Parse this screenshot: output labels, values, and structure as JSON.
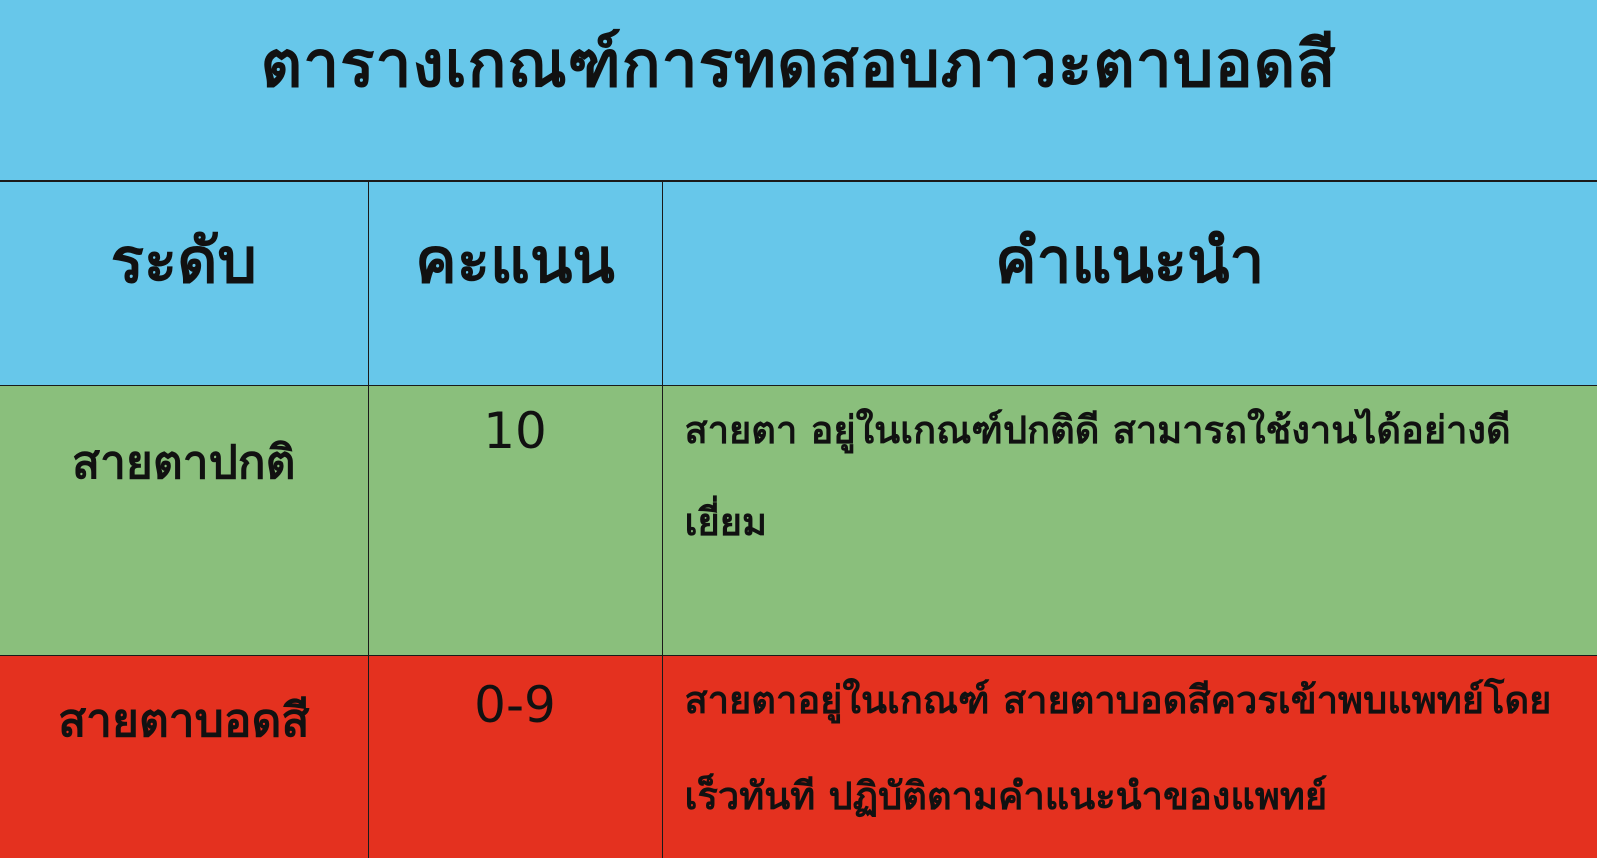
{
  "title": "ตารางเกณฑ์การทดสอบภาวะตาบอดสี",
  "colors": {
    "header_bg": "#67c7ea",
    "normal_bg": "#8abf7c",
    "blind_bg": "#e4311f"
  },
  "table": {
    "headers": [
      "ระดับ",
      "คะแนน",
      "คำแนะนำ"
    ],
    "rows": [
      {
        "level": "สายตาปกติ",
        "score": "10",
        "advice": "สายตา อยู่ในเกณฑ์ปกติดี สามารถใช้งานได้อย่างดีเยี่ยม"
      },
      {
        "level": "สายตาบอดสี",
        "score": "0-9",
        "advice": "สายตาอยู่ในเกณฑ์ สายตาบอดสีควรเข้าพบแพทย์โดยเร็วทันที ปฏิบัติตามคำแนะนำของแพทย์"
      }
    ]
  }
}
